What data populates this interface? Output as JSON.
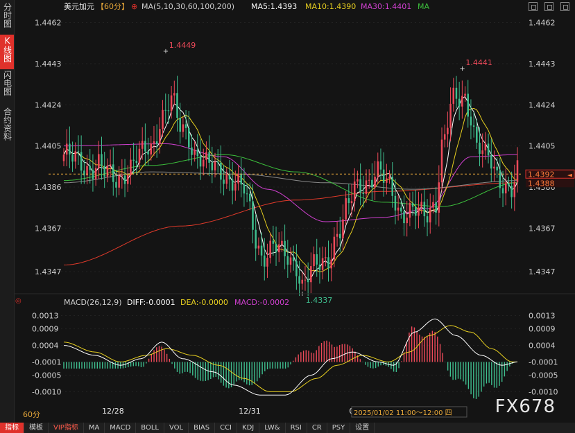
{
  "sidebar": {
    "tabs": [
      {
        "label": "分时图",
        "active": false
      },
      {
        "label": "K线图",
        "active": true
      },
      {
        "label": "闪电图",
        "active": false
      },
      {
        "label": "合约资料",
        "active": false
      }
    ]
  },
  "header": {
    "symbol": "美元加元",
    "period": "【60分】",
    "ma_params": "MA(5,10,30,60,100,200)",
    "ma5": "MA5:1.4393",
    "ma10": "MA10:1.4390",
    "ma30": "MA30:1.4401",
    "ma": "MA"
  },
  "macd_header": {
    "label": "MACD(26,12,9)",
    "diff": "DIFF:-0.0001",
    "dea": "DEA:-0.0000",
    "macd": "MACD:-0.0002"
  },
  "bottom_bar": {
    "period_label": "60分",
    "tabs": [
      "指标",
      "模板",
      "VIP指标",
      "MA",
      "MACD",
      "BOLL",
      "VOL",
      "BIAS",
      "CCI",
      "KDJ",
      "LW&",
      "RSI",
      "CR",
      "PSY",
      "设置"
    ],
    "active_tab": "指标",
    "vip_tab": "VIP指标"
  },
  "time_readout": "2025/01/02 11:00～12:00 四",
  "watermark": "FX678",
  "colors": {
    "up": "#ef4a5a",
    "down": "#3fbf8f",
    "ma5": "#ffffff",
    "ma10": "#e8d020",
    "ma30": "#d040d0",
    "ma60": "#3cbf3c",
    "ma100": "#8a8a8a",
    "ma200": "#e03a2a",
    "dea": "#e8d020",
    "diff": "#ffffff",
    "accent": "#e0312b"
  },
  "chart_data": [
    {
      "type": "candlestick",
      "title": "美元加元 60分",
      "y_ticks": [
        "1.4462",
        "1.4443",
        "1.4424",
        "1.4405",
        "1.4386",
        "1.4367",
        "1.4347"
      ],
      "ylim": [
        1.4338,
        1.4466
      ],
      "x_labels": [
        "12/28",
        "12/31",
        "01/01"
      ],
      "x_label_index": [
        16,
        63,
        101
      ],
      "current_price": "1.4392",
      "secondary_price": "1.4388",
      "annotations": [
        {
          "text": "1.4449",
          "index": 35,
          "price": 1.4449,
          "kind": "high"
        },
        {
          "text": "1.4441",
          "index": 137,
          "price": 1.4441,
          "kind": "high"
        },
        {
          "text": "1.4337",
          "index": 82,
          "price": 1.4337,
          "kind": "low"
        }
      ],
      "anchors": [
        [
          0,
          1.4401
        ],
        [
          4,
          1.4398
        ],
        [
          8,
          1.4395
        ],
        [
          12,
          1.4397
        ],
        [
          14,
          1.4392
        ],
        [
          18,
          1.4389
        ],
        [
          22,
          1.4395
        ],
        [
          26,
          1.44
        ],
        [
          30,
          1.4404
        ],
        [
          34,
          1.442
        ],
        [
          37,
          1.4426
        ],
        [
          40,
          1.4413
        ],
        [
          42,
          1.4411
        ],
        [
          46,
          1.4401
        ],
        [
          50,
          1.4395
        ],
        [
          54,
          1.4393
        ],
        [
          58,
          1.439
        ],
        [
          62,
          1.4384
        ],
        [
          64,
          1.4374
        ],
        [
          66,
          1.4362
        ],
        [
          68,
          1.4355
        ],
        [
          72,
          1.4358
        ],
        [
          76,
          1.4354
        ],
        [
          80,
          1.4351
        ],
        [
          82,
          1.4341
        ],
        [
          86,
          1.4348
        ],
        [
          90,
          1.4352
        ],
        [
          94,
          1.4364
        ],
        [
          98,
          1.4376
        ],
        [
          100,
          1.4386
        ],
        [
          104,
          1.4389
        ],
        [
          108,
          1.4392
        ],
        [
          112,
          1.4386
        ],
        [
          116,
          1.4375
        ],
        [
          120,
          1.4374
        ],
        [
          124,
          1.4373
        ],
        [
          128,
          1.438
        ],
        [
          130,
          1.4405
        ],
        [
          134,
          1.4425
        ],
        [
          138,
          1.4428
        ],
        [
          140,
          1.442
        ],
        [
          142,
          1.4405
        ],
        [
          146,
          1.4398
        ],
        [
          150,
          1.439
        ],
        [
          154,
          1.4385
        ],
        [
          156,
          1.4392
        ]
      ],
      "ma_lines": {
        "ma200": [
          [
            0,
            1.435
          ],
          [
            40,
            1.4368
          ],
          [
            80,
            1.438
          ],
          [
            110,
            1.4384
          ],
          [
            156,
            1.4388
          ]
        ],
        "ma100": [
          [
            0,
            1.4388
          ],
          [
            30,
            1.4393
          ],
          [
            60,
            1.4392
          ],
          [
            90,
            1.4388
          ],
          [
            120,
            1.4385
          ],
          [
            156,
            1.4389
          ]
        ],
        "ma60": [
          [
            0,
            1.4389
          ],
          [
            30,
            1.4396
          ],
          [
            55,
            1.4401
          ],
          [
            80,
            1.4393
          ],
          [
            110,
            1.4379
          ],
          [
            130,
            1.4377
          ],
          [
            156,
            1.4388
          ]
        ],
        "ma30": [
          [
            0,
            1.4405
          ],
          [
            35,
            1.4406
          ],
          [
            55,
            1.44
          ],
          [
            70,
            1.4385
          ],
          [
            90,
            1.437
          ],
          [
            110,
            1.4372
          ],
          [
            125,
            1.4376
          ],
          [
            140,
            1.44
          ],
          [
            156,
            1.4401
          ]
        ]
      }
    },
    {
      "type": "macd",
      "title": "MACD(26,12,9)",
      "y_ticks": [
        "0.0013",
        "0.0009",
        "0.0004",
        "-0.0001",
        "-0.0005",
        "-0.0010"
      ],
      "ylim": [
        -0.0012,
        0.0015
      ],
      "diff": [
        [
          0,
          0.0004
        ],
        [
          12,
          0.0001
        ],
        [
          22,
          -0.0002
        ],
        [
          30,
          0.0
        ],
        [
          38,
          0.0005
        ],
        [
          46,
          0.0
        ],
        [
          58,
          -0.0004
        ],
        [
          66,
          -0.0008
        ],
        [
          76,
          -0.0011
        ],
        [
          86,
          -0.0011
        ],
        [
          96,
          -0.0005
        ],
        [
          104,
          0.0
        ],
        [
          112,
          0.0002
        ],
        [
          122,
          -0.0001
        ],
        [
          128,
          -0.0002
        ],
        [
          136,
          0.0008
        ],
        [
          144,
          0.0012
        ],
        [
          152,
          0.0007
        ],
        [
          162,
          0.0001
        ],
        [
          170,
          -0.0002
        ],
        [
          176,
          -0.0001
        ]
      ],
      "dea": [
        [
          0,
          0.0005
        ],
        [
          12,
          0.0002
        ],
        [
          22,
          -0.0001
        ],
        [
          32,
          0.0001
        ],
        [
          40,
          0.0003
        ],
        [
          50,
          0.0001
        ],
        [
          60,
          -0.0002
        ],
        [
          70,
          -0.0006
        ],
        [
          80,
          -0.001
        ],
        [
          88,
          -0.001
        ],
        [
          98,
          -0.0006
        ],
        [
          106,
          -0.0002
        ],
        [
          116,
          0.0001
        ],
        [
          126,
          -0.0001
        ],
        [
          134,
          0.0002
        ],
        [
          142,
          0.0007
        ],
        [
          150,
          0.001
        ],
        [
          158,
          0.0008
        ],
        [
          166,
          0.0003
        ],
        [
          174,
          -0.0001
        ],
        [
          176,
          -0.0001
        ]
      ]
    }
  ]
}
